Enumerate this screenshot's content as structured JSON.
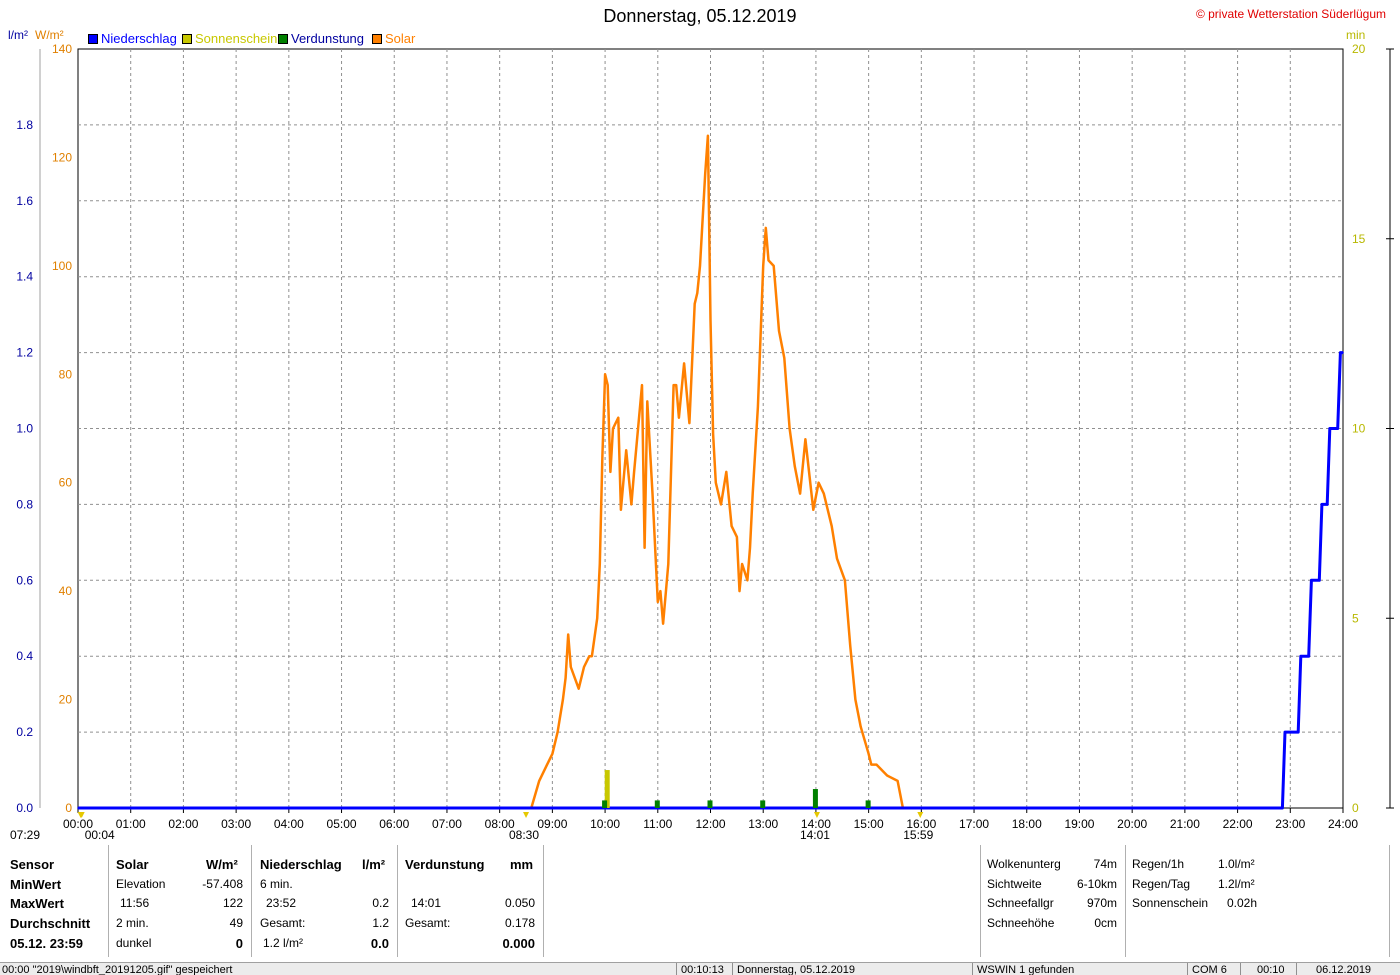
{
  "header": {
    "title": "Donnerstag, 05.12.2019",
    "copyright": "© private Wetterstation Süderlügum",
    "left_unit_1": "l/m²",
    "left_unit_2": "W/m²",
    "right_unit": "min"
  },
  "legend": [
    {
      "label": "Niederschlag",
      "color": "#0000ff"
    },
    {
      "label": "Sonnenschein",
      "color": "#c8c800"
    },
    {
      "label": "Verdunstung",
      "color": "#008000"
    },
    {
      "label": "Solar",
      "color": "#ff8000"
    }
  ],
  "chart_data": {
    "type": "line",
    "title": "Donnerstag, 05.12.2019",
    "x_ticks": [
      "00:00",
      "01:00",
      "02:00",
      "03:00",
      "04:00",
      "05:00",
      "06:00",
      "07:00",
      "08:00",
      "09:00",
      "10:00",
      "11:00",
      "12:00",
      "13:00",
      "14:00",
      "15:00",
      "16:00",
      "17:00",
      "18:00",
      "19:00",
      "20:00",
      "21:00",
      "22:00",
      "23:00",
      "24:00"
    ],
    "xlim_hours": [
      0,
      24
    ],
    "axes": {
      "precip_l_m2": {
        "lim": [
          0,
          2.0
        ],
        "ticks": [
          "0.0",
          "0.2",
          "0.4",
          "0.6",
          "0.8",
          "1.0",
          "1.2",
          "1.4",
          "1.6",
          "1.8"
        ],
        "color": "#0000a0"
      },
      "solar_w_m2": {
        "lim": [
          0,
          140
        ],
        "ticks": [
          "0",
          "20",
          "40",
          "60",
          "80",
          "100",
          "120",
          "140"
        ],
        "color": "#e08000"
      },
      "sunshine_min": {
        "lim": [
          0,
          20
        ],
        "ticks": [
          "0",
          "5",
          "10",
          "15",
          "20"
        ],
        "color": "#c8c800"
      }
    },
    "grid": true,
    "series": [
      {
        "name": "Solar",
        "axis": "solar_w_m2",
        "color": "#ff8000",
        "points": [
          [
            8.5,
            0
          ],
          [
            8.6,
            0
          ],
          [
            8.75,
            5
          ],
          [
            8.9,
            8
          ],
          [
            9.0,
            10
          ],
          [
            9.1,
            14
          ],
          [
            9.2,
            20
          ],
          [
            9.25,
            24
          ],
          [
            9.3,
            32
          ],
          [
            9.35,
            26
          ],
          [
            9.5,
            22
          ],
          [
            9.6,
            26
          ],
          [
            9.7,
            28
          ],
          [
            9.75,
            28
          ],
          [
            9.85,
            35
          ],
          [
            9.9,
            45
          ],
          [
            9.95,
            65
          ],
          [
            10.0,
            80
          ],
          [
            10.05,
            78
          ],
          [
            10.1,
            62
          ],
          [
            10.15,
            70
          ],
          [
            10.25,
            72
          ],
          [
            10.3,
            55
          ],
          [
            10.4,
            66
          ],
          [
            10.5,
            56
          ],
          [
            10.55,
            62
          ],
          [
            10.7,
            78
          ],
          [
            10.75,
            48
          ],
          [
            10.8,
            75
          ],
          [
            10.9,
            58
          ],
          [
            11.0,
            38
          ],
          [
            11.05,
            40
          ],
          [
            11.1,
            34
          ],
          [
            11.2,
            45
          ],
          [
            11.3,
            78
          ],
          [
            11.35,
            78
          ],
          [
            11.4,
            72
          ],
          [
            11.5,
            82
          ],
          [
            11.6,
            71
          ],
          [
            11.7,
            93
          ],
          [
            11.75,
            95
          ],
          [
            11.8,
            100
          ],
          [
            11.9,
            117
          ],
          [
            11.95,
            124
          ],
          [
            12.0,
            90
          ],
          [
            12.05,
            69
          ],
          [
            12.1,
            60
          ],
          [
            12.2,
            56
          ],
          [
            12.3,
            62
          ],
          [
            12.4,
            52
          ],
          [
            12.5,
            50
          ],
          [
            12.55,
            40
          ],
          [
            12.6,
            45
          ],
          [
            12.7,
            42
          ],
          [
            12.75,
            48
          ],
          [
            12.8,
            58
          ],
          [
            12.9,
            74
          ],
          [
            13.0,
            100
          ],
          [
            13.05,
            107
          ],
          [
            13.1,
            101
          ],
          [
            13.2,
            100
          ],
          [
            13.3,
            88
          ],
          [
            13.4,
            83
          ],
          [
            13.5,
            70
          ],
          [
            13.6,
            63
          ],
          [
            13.7,
            58
          ],
          [
            13.8,
            68
          ],
          [
            13.95,
            55
          ],
          [
            14.05,
            60
          ],
          [
            14.15,
            58
          ],
          [
            14.3,
            52
          ],
          [
            14.4,
            46
          ],
          [
            14.55,
            42
          ],
          [
            14.65,
            30
          ],
          [
            14.75,
            20
          ],
          [
            14.85,
            15
          ],
          [
            15.0,
            10
          ],
          [
            15.05,
            8
          ],
          [
            15.15,
            8
          ],
          [
            15.35,
            6
          ],
          [
            15.55,
            5
          ],
          [
            15.65,
            0
          ]
        ]
      },
      {
        "name": "Niederschlag",
        "axis": "precip_l_m2",
        "color": "#0000ff",
        "points": [
          [
            0,
            0
          ],
          [
            22.85,
            0
          ],
          [
            22.9,
            0.2
          ],
          [
            23.15,
            0.2
          ],
          [
            23.2,
            0.4
          ],
          [
            23.35,
            0.4
          ],
          [
            23.4,
            0.6
          ],
          [
            23.55,
            0.6
          ],
          [
            23.6,
            0.8
          ],
          [
            23.7,
            0.8
          ],
          [
            23.75,
            1.0
          ],
          [
            23.9,
            1.0
          ],
          [
            23.95,
            1.2
          ],
          [
            24.0,
            1.2
          ]
        ]
      },
      {
        "name": "Sonnenschein",
        "axis": "sunshine_min",
        "color": "#c8c800",
        "bars": [
          [
            10.05,
            1
          ]
        ]
      },
      {
        "name": "Verdunstung",
        "axis": "precip_l_m2",
        "color": "#008000",
        "bars": [
          [
            10.0,
            0.02
          ],
          [
            11.0,
            0.02
          ],
          [
            12.0,
            0.02
          ],
          [
            13.0,
            0.02
          ],
          [
            14.0,
            0.05
          ],
          [
            15.0,
            0.02
          ]
        ]
      }
    ],
    "markers": [
      {
        "label": "07:29",
        "hour": 0.05
      },
      {
        "label": "00:04",
        "hour": 0.07
      },
      {
        "label": "08:30",
        "hour": 8.5
      },
      {
        "label": "14:01",
        "hour": 14.02
      },
      {
        "label": "15:59",
        "hour": 15.98
      }
    ]
  },
  "panels": {
    "sensor": {
      "head": "Sensor",
      "rows": [
        "MinWert",
        "MaxWert",
        "Durchschnitt",
        "05.12. 23:59"
      ]
    },
    "solar": {
      "head": "Solar",
      "unit": "W/m²",
      "rows": [
        [
          "Elevation",
          "-57.408"
        ],
        [
          "11:56",
          "122"
        ],
        [
          "2 min.",
          "49"
        ],
        [
          "dunkel",
          "0"
        ]
      ]
    },
    "niederschlag": {
      "head": "Niederschlag",
      "unit": "l/m²",
      "rows": [
        [
          "6 min.",
          ""
        ],
        [
          "23:52",
          "0.2"
        ],
        [
          "Gesamt:",
          "1.2"
        ],
        [
          "1.2 l/m²",
          "0.0"
        ]
      ]
    },
    "verdunstung": {
      "head": "Verdunstung",
      "unit": "mm",
      "rows": [
        [
          "",
          ""
        ],
        [
          "14:01",
          "0.050"
        ],
        [
          "Gesamt:",
          "0.178"
        ],
        [
          "",
          "0.000"
        ]
      ]
    },
    "weather": {
      "rows": [
        [
          "Wolkenunterg",
          "74m"
        ],
        [
          "Sichtweite",
          "6-10km"
        ],
        [
          "Schneefallgr",
          "970m"
        ],
        [
          "Schneehöhe",
          "0cm"
        ]
      ]
    },
    "rain": {
      "rows": [
        [
          "Regen/1h",
          "1.0l/m²"
        ],
        [
          "Regen/Tag",
          "1.2l/m²"
        ],
        [
          "Sonnenschein",
          "0.02h"
        ]
      ]
    }
  },
  "statusbar": {
    "message": "00:00 \"2019\\windbft_20191205.gif\" gespeichert",
    "time1": "00:10:13",
    "date_label": "Donnerstag, 05.12.2019",
    "wswin": "WSWIN 1 gefunden",
    "com": "COM 6",
    "time2": "00:10",
    "date": "06.12.2019"
  }
}
